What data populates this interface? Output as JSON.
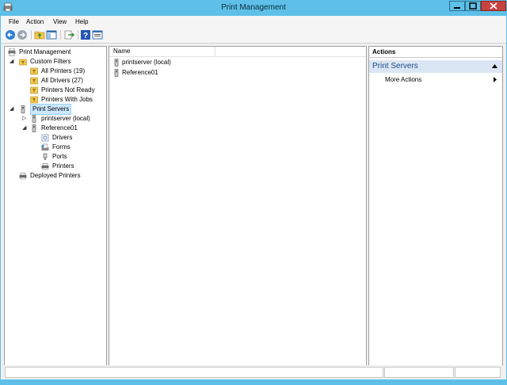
{
  "window": {
    "title": "Print Management",
    "controls": [
      "minimize",
      "maximize",
      "close"
    ]
  },
  "menubar": {
    "items": [
      "File",
      "Action",
      "View",
      "Help"
    ]
  },
  "toolbar": {
    "buttons": [
      "back-icon",
      "forward-icon",
      "up-folder-icon",
      "show-hide-tree-icon",
      "export-list-icon",
      "help-icon",
      "properties-icon"
    ]
  },
  "tree": {
    "root": "Print Management",
    "custom_filters": "Custom Filters",
    "filters": [
      "All Printers (19)",
      "All Drivers (27)",
      "Printers Not Ready",
      "Printers With Jobs"
    ],
    "print_servers": "Print Servers",
    "servers": [
      "printserver (local)",
      "Reference01"
    ],
    "server_children": [
      "Drivers",
      "Forms",
      "Ports",
      "Printers"
    ],
    "deployed_printers": "Deployed Printers"
  },
  "list": {
    "column_name": "Name",
    "rows": [
      "printserver (local)",
      "Reference01"
    ]
  },
  "actions": {
    "title": "Actions",
    "group": "Print Servers",
    "more": "More Actions"
  },
  "colors": {
    "titlebar": "#5ec0e8",
    "selection": "#cce8ff",
    "actions_group_bg": "#dbe6f4",
    "actions_group_text": "#1e4a87",
    "close_button": "#c7423f"
  }
}
